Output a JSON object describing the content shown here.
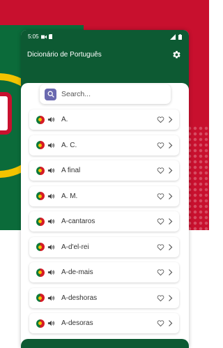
{
  "status_bar": {
    "time": "5:05"
  },
  "app": {
    "title": "Dicionário de Português"
  },
  "search": {
    "placeholder": "Search..."
  },
  "words": [
    {
      "label": "A."
    },
    {
      "label": "A. C."
    },
    {
      "label": "A final"
    },
    {
      "label": "A. M."
    },
    {
      "label": "A-cantaros"
    },
    {
      "label": "A-d'el-rei"
    },
    {
      "label": "A-de-mais"
    },
    {
      "label": "A-deshoras"
    },
    {
      "label": "A-desoras"
    }
  ],
  "colors": {
    "header_green": "#0d5a33",
    "search_accent": "#6a69b0",
    "flag_red": "#c8102e",
    "flag_green": "#0b6b3a"
  },
  "icons": {
    "settings": "gear-icon",
    "search": "search-icon",
    "row_flag": "portugal-flag-icon",
    "row_audio": "speaker-icon",
    "row_favorite": "heart-icon",
    "row_open": "chevron-right-icon"
  }
}
